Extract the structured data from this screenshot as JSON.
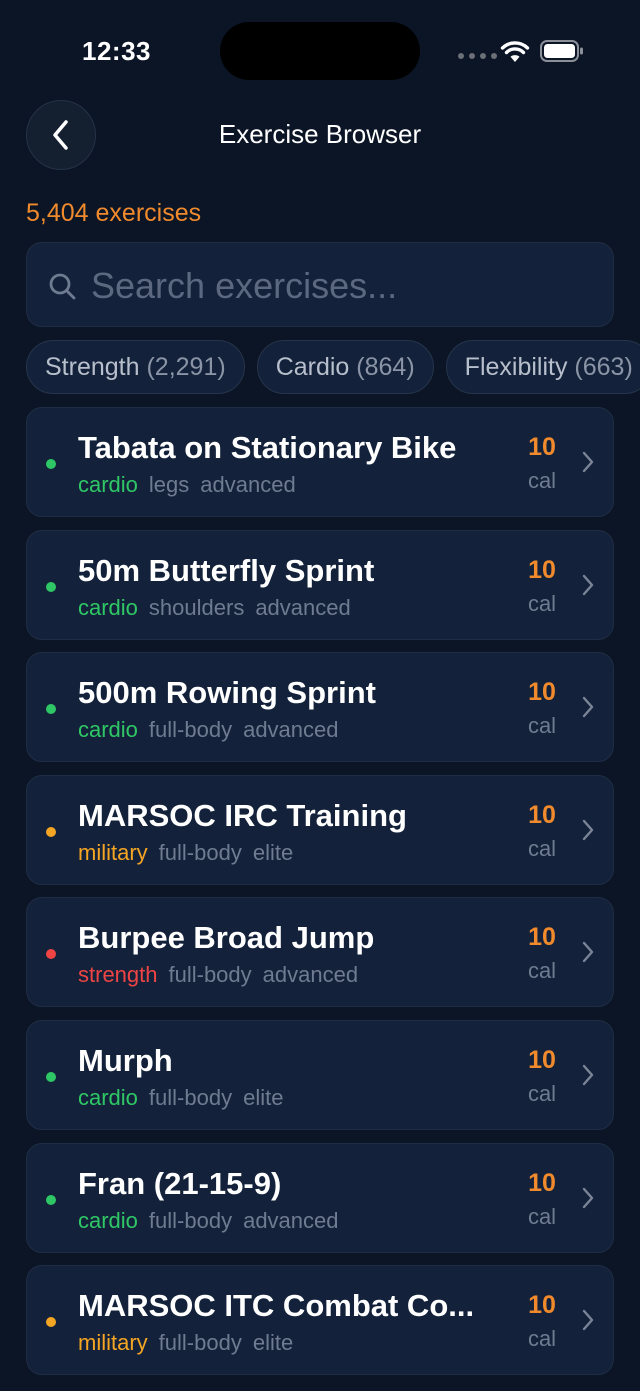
{
  "status": {
    "time": "12:33"
  },
  "header": {
    "title": "Exercise Browser"
  },
  "summary": {
    "count": "5,404 exercises"
  },
  "search": {
    "placeholder": "Search exercises..."
  },
  "filters": [
    {
      "label": "Strength",
      "count": "(2,291)"
    },
    {
      "label": "Cardio",
      "count": "(864)"
    },
    {
      "label": "Flexibility",
      "count": "(663)"
    }
  ],
  "colors": {
    "cardio": "#2fc765",
    "military": "#f5a524",
    "strength": "#ef4444",
    "accent": "#f08a2c"
  },
  "exercises": [
    {
      "name": "Tabata on Stationary Bike",
      "category": "cardio",
      "muscle": "legs",
      "level": "advanced",
      "cal": "10",
      "unit": "cal"
    },
    {
      "name": "50m Butterfly Sprint",
      "category": "cardio",
      "muscle": "shoulders",
      "level": "advanced",
      "cal": "10",
      "unit": "cal"
    },
    {
      "name": "500m Rowing Sprint",
      "category": "cardio",
      "muscle": "full-body",
      "level": "advanced",
      "cal": "10",
      "unit": "cal"
    },
    {
      "name": "MARSOC IRC Training",
      "category": "military",
      "muscle": "full-body",
      "level": "elite",
      "cal": "10",
      "unit": "cal"
    },
    {
      "name": "Burpee Broad Jump",
      "category": "strength",
      "muscle": "full-body",
      "level": "advanced",
      "cal": "10",
      "unit": "cal"
    },
    {
      "name": "Murph",
      "category": "cardio",
      "muscle": "full-body",
      "level": "elite",
      "cal": "10",
      "unit": "cal"
    },
    {
      "name": "Fran (21-15-9)",
      "category": "cardio",
      "muscle": "full-body",
      "level": "advanced",
      "cal": "10",
      "unit": "cal"
    },
    {
      "name": "MARSOC ITC Combat Co...",
      "category": "military",
      "muscle": "full-body",
      "level": "elite",
      "cal": "10",
      "unit": "cal"
    }
  ]
}
